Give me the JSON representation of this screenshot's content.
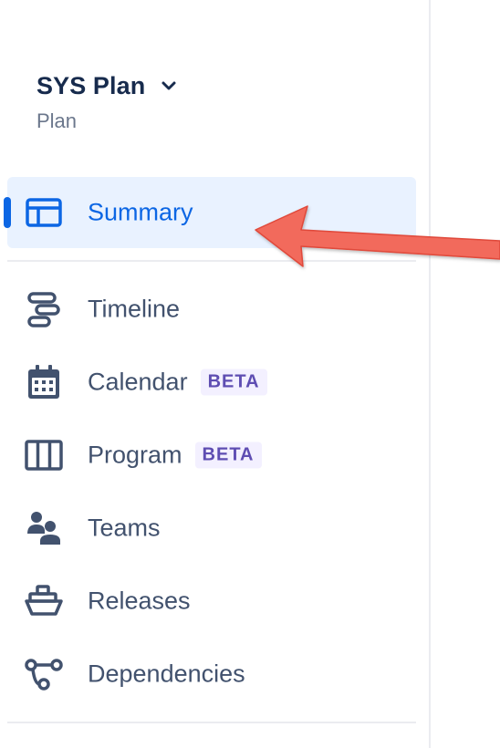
{
  "plan": {
    "title": "SYS Plan",
    "subtitle": "Plan"
  },
  "nav": {
    "summary": {
      "label": "Summary",
      "icon": "summary-layout-icon",
      "selected": true
    },
    "items": [
      {
        "label": "Timeline",
        "icon": "timeline-icon"
      },
      {
        "label": "Calendar",
        "icon": "calendar-icon",
        "badge": "BETA"
      },
      {
        "label": "Program",
        "icon": "program-columns-icon",
        "badge": "BETA"
      },
      {
        "label": "Teams",
        "icon": "teams-icon"
      },
      {
        "label": "Releases",
        "icon": "releases-ship-icon"
      },
      {
        "label": "Dependencies",
        "icon": "dependencies-icon"
      }
    ]
  },
  "colors": {
    "accent": "#0C66E4",
    "selected_bg": "#E9F2FF",
    "badge_bg": "#F3F0FF",
    "badge_text": "#5E4DB2",
    "text": "#42526E",
    "title": "#172B4D",
    "annotation_arrow": "#F26B5B"
  }
}
